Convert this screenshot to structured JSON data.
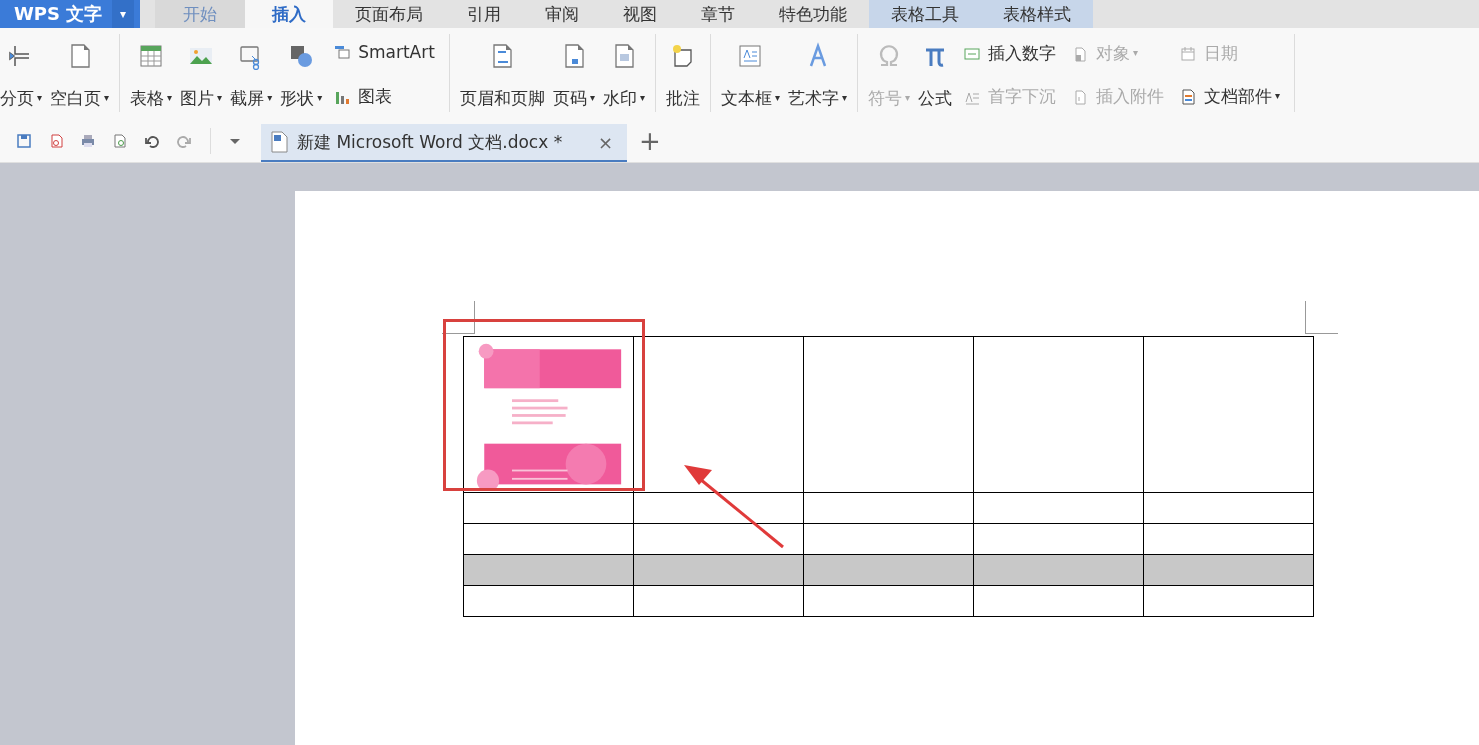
{
  "app": {
    "title": "WPS 文字",
    "menu_caret": "▾"
  },
  "tabs": [
    {
      "label": "开始",
      "selected": false,
      "contextual": false
    },
    {
      "label": "插入",
      "selected": true,
      "contextual": false
    },
    {
      "label": "页面布局",
      "selected": false,
      "contextual": false
    },
    {
      "label": "引用",
      "selected": false,
      "contextual": false
    },
    {
      "label": "审阅",
      "selected": false,
      "contextual": false
    },
    {
      "label": "视图",
      "selected": false,
      "contextual": false
    },
    {
      "label": "章节",
      "selected": false,
      "contextual": false
    },
    {
      "label": "特色功能",
      "selected": false,
      "contextual": false
    },
    {
      "label": "表格工具",
      "selected": false,
      "contextual": true
    },
    {
      "label": "表格样式",
      "selected": false,
      "contextual": true
    }
  ],
  "ribbon": {
    "groups": [
      {
        "items": [
          {
            "kind": "large",
            "label": "分页",
            "dropdown": true,
            "disabled": false
          },
          {
            "kind": "large",
            "label": "空白页",
            "dropdown": true,
            "disabled": false
          }
        ]
      },
      {
        "items": [
          {
            "kind": "large",
            "label": "表格",
            "dropdown": true,
            "disabled": false
          },
          {
            "kind": "large",
            "label": "图片",
            "dropdown": true,
            "disabled": false
          },
          {
            "kind": "large",
            "label": "截屏",
            "dropdown": true,
            "disabled": false
          },
          {
            "kind": "large",
            "label": "形状",
            "dropdown": true,
            "disabled": false
          },
          {
            "kind": "stack",
            "items": [
              {
                "label": "SmartArt",
                "dropdown": false,
                "disabled": false
              },
              {
                "label": "图表",
                "dropdown": false,
                "disabled": false
              }
            ]
          }
        ]
      },
      {
        "items": [
          {
            "kind": "large",
            "label": "页眉和页脚",
            "dropdown": false,
            "disabled": false
          },
          {
            "kind": "large",
            "label": "页码",
            "dropdown": true,
            "disabled": false
          },
          {
            "kind": "large",
            "label": "水印",
            "dropdown": true,
            "disabled": false
          }
        ]
      },
      {
        "items": [
          {
            "kind": "large",
            "label": "批注",
            "dropdown": false,
            "disabled": false
          }
        ]
      },
      {
        "items": [
          {
            "kind": "large",
            "label": "文本框",
            "dropdown": true,
            "disabled": false
          },
          {
            "kind": "large",
            "label": "艺术字",
            "dropdown": true,
            "disabled": false
          }
        ]
      },
      {
        "items": [
          {
            "kind": "large",
            "label": "符号",
            "dropdown": true,
            "disabled": true
          },
          {
            "kind": "large",
            "label": "公式",
            "dropdown": false,
            "disabled": false
          },
          {
            "kind": "stack",
            "items": [
              {
                "label": "插入数字",
                "dropdown": false,
                "disabled": false
              },
              {
                "label": "首字下沉",
                "dropdown": false,
                "disabled": true
              }
            ]
          },
          {
            "kind": "stack",
            "items": [
              {
                "label": "对象",
                "dropdown": true,
                "disabled": true
              },
              {
                "label": "插入附件",
                "dropdown": false,
                "disabled": true
              }
            ]
          },
          {
            "kind": "stack",
            "items": [
              {
                "label": "日期",
                "dropdown": false,
                "disabled": true
              },
              {
                "label": "文档部件",
                "dropdown": true,
                "disabled": false
              }
            ]
          }
        ]
      }
    ]
  },
  "doc_tab": {
    "title": "新建 Microsoft Word 文档.docx *",
    "close": "×",
    "new_tab": "+",
    "selected": true
  },
  "table": {
    "rows": [
      {
        "selected": false,
        "cells": [
          {
            "kind": "picture"
          },
          {
            "kind": "empty"
          },
          {
            "kind": "empty"
          },
          {
            "kind": "empty"
          },
          {
            "kind": "empty"
          }
        ]
      },
      {
        "selected": false,
        "cells": [
          {
            "kind": "empty"
          },
          {
            "kind": "empty"
          },
          {
            "kind": "empty"
          },
          {
            "kind": "empty"
          },
          {
            "kind": "empty"
          }
        ]
      },
      {
        "selected": false,
        "cells": [
          {
            "kind": "empty"
          },
          {
            "kind": "empty"
          },
          {
            "kind": "empty"
          },
          {
            "kind": "empty"
          },
          {
            "kind": "empty"
          }
        ]
      },
      {
        "selected": true,
        "cells": [
          {
            "kind": "empty"
          },
          {
            "kind": "empty"
          },
          {
            "kind": "empty"
          },
          {
            "kind": "empty"
          },
          {
            "kind": "empty"
          }
        ]
      },
      {
        "selected": false,
        "cells": [
          {
            "kind": "empty"
          },
          {
            "kind": "empty"
          },
          {
            "kind": "empty"
          },
          {
            "kind": "empty"
          },
          {
            "kind": "empty"
          }
        ]
      }
    ]
  }
}
